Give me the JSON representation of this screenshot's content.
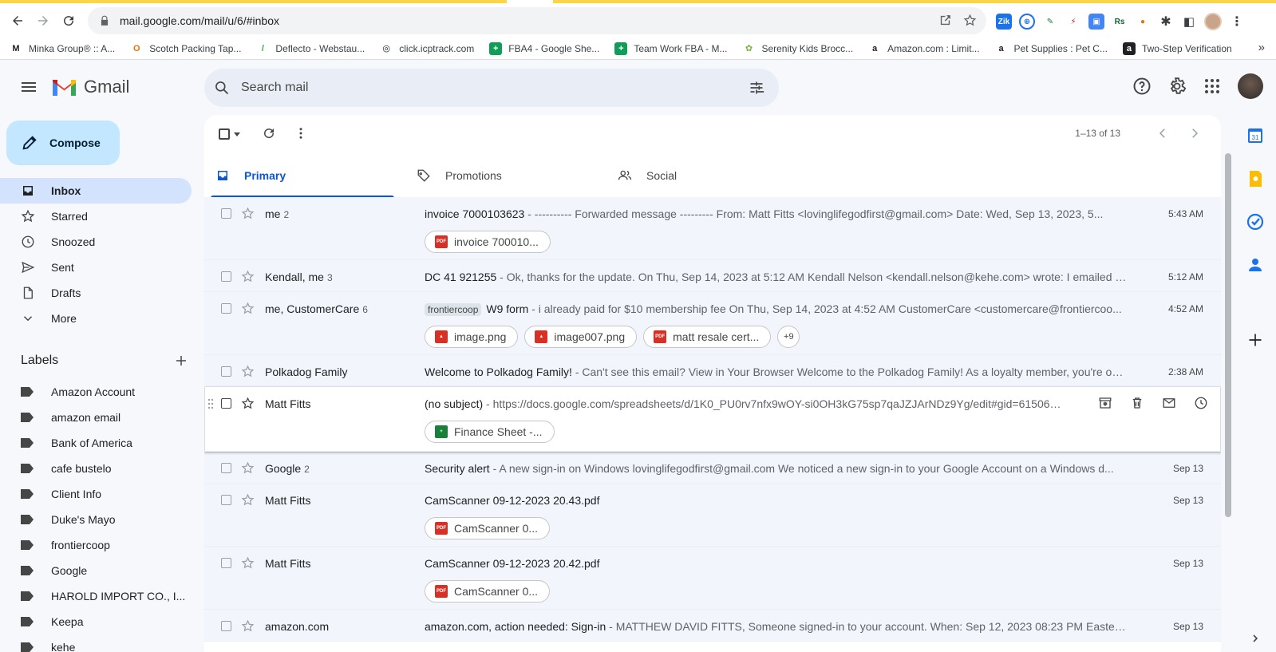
{
  "browser": {
    "url": "mail.google.com/mail/u/6/#inbox",
    "bookmarks": [
      {
        "label": "Minka Group® :: A...",
        "icon": "M",
        "color": "#202124"
      },
      {
        "label": "Scotch Packing Tap...",
        "icon": "O",
        "color": "#e8710a"
      },
      {
        "label": "Deflecto - Webstau...",
        "icon": "/",
        "color": "#34a853"
      },
      {
        "label": "click.icptrack.com",
        "icon": "◎",
        "color": "#202124"
      },
      {
        "label": "FBA4 - Google She...",
        "icon": "+",
        "color": "#0f9d58"
      },
      {
        "label": "Team Work FBA - M...",
        "icon": "+",
        "color": "#0f9d58"
      },
      {
        "label": "Serenity Kids Brocc...",
        "icon": "✿",
        "color": "#7cb342"
      },
      {
        "label": "Amazon.com : Limit...",
        "icon": "a",
        "color": "#202124"
      },
      {
        "label": "Pet Supplies : Pet C...",
        "icon": "a",
        "color": "#202124"
      },
      {
        "label": "Two-Step Verification",
        "icon": "a",
        "color": "#202124"
      }
    ],
    "more": "»"
  },
  "header": {
    "app_name": "Gmail",
    "search_placeholder": "Search mail"
  },
  "sidebar": {
    "compose_label": "Compose",
    "items": [
      {
        "label": "Inbox",
        "icon": "inbox-icon",
        "active": true
      },
      {
        "label": "Starred",
        "icon": "star-icon"
      },
      {
        "label": "Snoozed",
        "icon": "clock-icon"
      },
      {
        "label": "Sent",
        "icon": "send-icon"
      },
      {
        "label": "Drafts",
        "icon": "draft-icon"
      },
      {
        "label": "More",
        "icon": "chevron-down-icon"
      }
    ],
    "labels_title": "Labels",
    "labels": [
      "Amazon Account",
      "amazon email",
      "Bank of America",
      "cafe bustelo",
      "Client Info",
      "Duke's Mayo",
      "frontiercoop",
      "Google",
      "HAROLD IMPORT CO., I...",
      "Keepa",
      "kehe"
    ]
  },
  "toolbar": {
    "pager_text": "1–13 of 13"
  },
  "tabs": [
    {
      "label": "Primary",
      "icon": "inbox-tab-icon",
      "active": true
    },
    {
      "label": "Promotions",
      "icon": "tag-icon"
    },
    {
      "label": "Social",
      "icon": "people-icon"
    }
  ],
  "emails": [
    {
      "sender": "me",
      "count": "2",
      "subject": "invoice 7000103623",
      "snippet": " - ---------- Forwarded message --------- From: Matt Fitts <lovinglifegodfirst@gmail.com> Date: Wed, Sep 13, 2023, 5...",
      "time": "5:43 AM",
      "attachments": [
        {
          "name": "invoice 700010...",
          "type": "pdf"
        }
      ]
    },
    {
      "sender": "Kendall, me",
      "count": "3",
      "subject": "DC 41 921255",
      "snippet": " - Ok, thanks for the update. On Thu, Sep 14, 2023 at 5:12 AM Kendall Nelson <kendall.nelson@kehe.com> wrote: I emailed Co...",
      "time": "5:12 AM",
      "attachments": []
    },
    {
      "sender": "me, CustomerCare",
      "count": "6",
      "label_chip": "frontiercoop",
      "subject": "W9 form",
      "snippet": " - i already paid for $10 membership fee On Thu, Sep 14, 2023 at 4:52 AM CustomerCare <customercare@frontiercoo...",
      "time": "4:52 AM",
      "attachments": [
        {
          "name": "image.png",
          "type": "img"
        },
        {
          "name": "image007.png",
          "type": "img"
        },
        {
          "name": "matt resale cert...",
          "type": "pdf"
        }
      ],
      "more_attachments": "+9"
    },
    {
      "sender": "Polkadog Family",
      "count": "",
      "subject": "Welcome to Polkadog Family!",
      "snippet": " - Can't see this email? View in Your Browser Welcome to the Polkadog Family! As a loyalty member, you're on...",
      "time": "2:38 AM",
      "attachments": []
    },
    {
      "sender": "Matt Fitts",
      "count": "",
      "subject": "(no subject)",
      "snippet": " - https://docs.google.com/spreadsheets/d/1K0_PU0rv7nfx9wOY-si0OH3kG75sp7qaJZJArNDz9Yg/edit#gid=615066...",
      "time": "",
      "hover": true,
      "attachments": [
        {
          "name": "Finance Sheet -...",
          "type": "sheet"
        }
      ]
    },
    {
      "sender": "Google",
      "count": "2",
      "subject": "Security alert",
      "snippet": " - A new sign-in on Windows lovinglifegodfirst@gmail.com We noticed a new sign-in to your Google Account on a Windows d...",
      "time": "Sep 13",
      "attachments": []
    },
    {
      "sender": "Matt Fitts",
      "count": "",
      "subject": "CamScanner 09-12-2023 20.43.pdf",
      "snippet": "",
      "time": "Sep 13",
      "attachments": [
        {
          "name": "CamScanner 0...",
          "type": "pdf"
        }
      ]
    },
    {
      "sender": "Matt Fitts",
      "count": "",
      "subject": "CamScanner 09-12-2023 20.42.pdf",
      "snippet": "",
      "time": "Sep 13",
      "attachments": [
        {
          "name": "CamScanner 0...",
          "type": "pdf"
        }
      ]
    },
    {
      "sender": "amazon.com",
      "count": "",
      "subject": "amazon.com, action needed: Sign-in",
      "snippet": " - MATTHEW DAVID FITTS, Someone signed-in to your account. When: Sep 12, 2023 08:23 PM Eastern...",
      "time": "Sep 13",
      "attachments": []
    }
  ],
  "colors": {
    "accent": "#0b57d0",
    "compose_bg": "#c2e7ff",
    "active_nav": "#d3e3fd",
    "pdf_red": "#d93025",
    "sheet_green": "#188038"
  }
}
